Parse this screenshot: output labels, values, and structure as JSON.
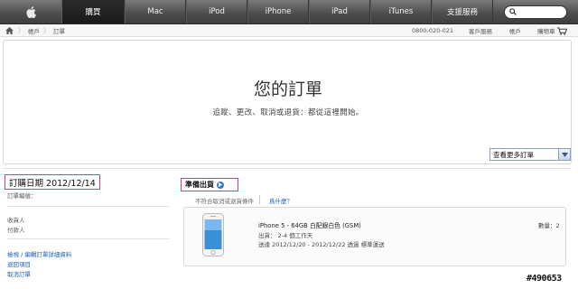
{
  "nav": {
    "items": [
      {
        "label": "購買",
        "active": true
      },
      {
        "label": "Mac"
      },
      {
        "label": "iPod"
      },
      {
        "label": "iPhone"
      },
      {
        "label": "iPad"
      },
      {
        "label": "iTunes"
      },
      {
        "label": "支援服務"
      }
    ],
    "search_icon": "search-icon",
    "logo_icon": "apple-logo-icon"
  },
  "breadcrumb": {
    "home_icon": "home-icon",
    "items": [
      "帳戶",
      "訂單"
    ],
    "phone": "0800-020-021",
    "links": [
      "客戶服務",
      "帳戶"
    ],
    "cart_label": "購物車",
    "cart_icon": "cart-icon"
  },
  "hero": {
    "title": "您的訂單",
    "subtitle": "追蹤、更改、取消或退貨：都從這裡開始。",
    "select_value": "查看更多訂單"
  },
  "order": {
    "date_label": "訂購日期 2012/12/14",
    "number_label": "訂單編號：",
    "receiver_label": "收貨人",
    "payer_label": "付款人",
    "links": [
      "檢視 / 編輯訂單詳細資料",
      "退回項目",
      "取消訂單"
    ]
  },
  "shipment": {
    "status": "準備出貨",
    "status_icon": "info-icon",
    "note": "不符合取消或退貨條件",
    "why_link": "爲什麼？",
    "item": {
      "name": "iPhone 5 - 64GB 白配銀白色 (GSM)",
      "ship_line": "出貨： 2-4 個工作天",
      "delivery_line": "送達 2012/12/20 - 2012/12/22 透過 標準運送",
      "qty": "數量：2"
    }
  },
  "watermark": "#490653",
  "colors": {
    "nav_bg": "#4e4e4e",
    "highlight_border": "#d23a8c",
    "link": "#1a5fb4"
  }
}
